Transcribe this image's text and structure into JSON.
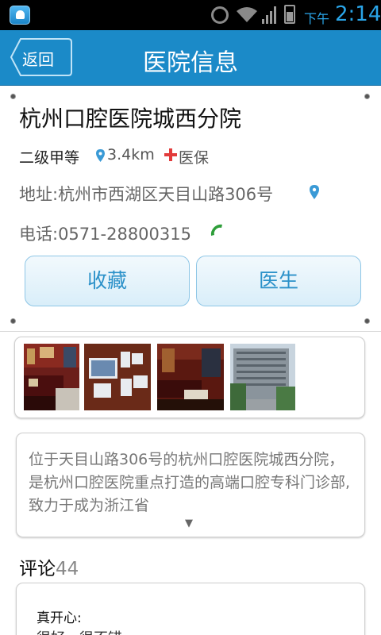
{
  "status_bar": {
    "ampm": "下午",
    "time": "2:14",
    "icons": [
      "app-notification-icon",
      "alarm-icon",
      "wifi-icon",
      "signal-icon",
      "battery-icon"
    ]
  },
  "header": {
    "back_label": "返回",
    "title": "医院信息"
  },
  "hospital": {
    "name": "杭州口腔医院城西分院",
    "level": "二级甲等",
    "distance": "3.4km",
    "insurance": "医保",
    "address": "地址:杭州市西湖区天目山路306号",
    "phone": "电话:0571-28800315"
  },
  "actions": {
    "favorite": "收藏",
    "doctors": "医生"
  },
  "gallery": {
    "photos": [
      "hospital-interior-lounge",
      "hospital-wall-frames",
      "hospital-interior-sofa",
      "hospital-building-exterior"
    ]
  },
  "description": {
    "text": "位于天目山路306号的杭州口腔医院城西分院，是杭州口腔医院重点打造的高端口腔专科门诊部,致力于成为浙江省",
    "expand_symbol": "▼"
  },
  "comments": {
    "title": "评论",
    "count": "44",
    "items": [
      {
        "user": "真开心:",
        "text": "很好，很不错"
      }
    ]
  },
  "colors": {
    "accent": "#1b8ac8",
    "button_text": "#2b91c9",
    "cross": "#e23b3b",
    "phone": "#2e9e3a"
  }
}
